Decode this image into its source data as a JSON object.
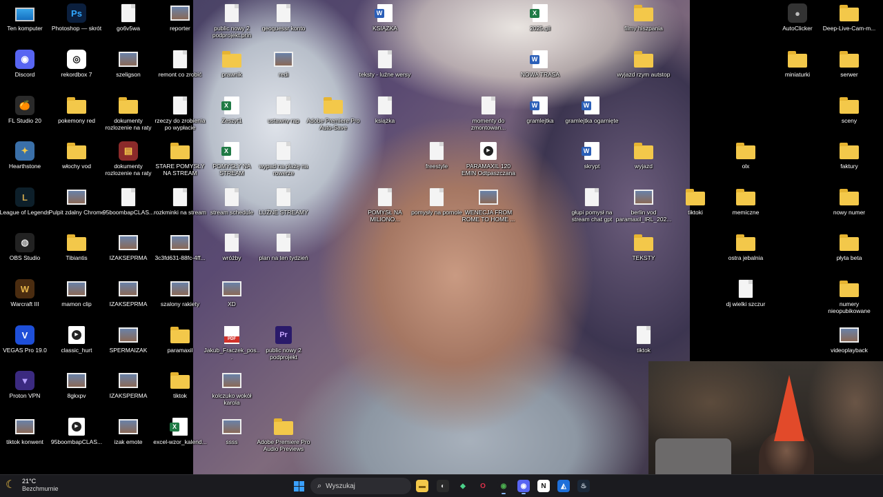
{
  "desktop": {
    "icons": [
      {
        "label": "Ten komputer",
        "type": "monitor"
      },
      {
        "label": "Photoshop — skrót",
        "type": "app",
        "color": "#0b1f3d",
        "text": "Ps",
        "tcolor": "#31a8ff"
      },
      {
        "label": "go6v5wa",
        "type": "doc"
      },
      {
        "label": "reporter",
        "type": "img"
      },
      {
        "label": "public nowy 2 podprojekt.prin",
        "type": "doc"
      },
      {
        "label": "geoguessr konto",
        "type": "doc"
      },
      {
        "label": "KSIĄŻKA",
        "type": "word"
      },
      {
        "label": "2025.gil",
        "type": "excel"
      },
      {
        "label": "filmy hiszpania",
        "type": "folder"
      },
      {
        "label": "AutoClicker",
        "type": "app",
        "color": "#333",
        "text": "●",
        "tcolor": "#bbb"
      },
      {
        "label": "Deep-Live-Cam-m...",
        "type": "folder"
      },
      {
        "label": "Discord",
        "type": "app",
        "color": "#5865f2",
        "text": "◉",
        "tcolor": "#fff"
      },
      {
        "label": "rekordbox 7",
        "type": "app",
        "color": "#fff",
        "text": "◎",
        "tcolor": "#111"
      },
      {
        "label": "szeligson",
        "type": "img"
      },
      {
        "label": "remont co zrobić",
        "type": "doc"
      },
      {
        "label": "prawnik",
        "type": "folder"
      },
      {
        "label": "redi",
        "type": "img"
      },
      {
        "label": "teksty - luźne wersy",
        "type": "doc"
      },
      {
        "label": "NOWA TRASA",
        "type": "word"
      },
      {
        "label": "wyjazd rzym autstop",
        "type": "folder"
      },
      {
        "label": "miniaturki",
        "type": "folder"
      },
      {
        "label": "serwer",
        "type": "folder"
      },
      {
        "label": "FL Studio 20",
        "type": "app",
        "color": "#2a2a2a",
        "text": "🍊",
        "tcolor": "#f90"
      },
      {
        "label": "pokemony red",
        "type": "folder"
      },
      {
        "label": "dokumenty rozlozenie na raty",
        "type": "folder"
      },
      {
        "label": "rzeczy do zrobienia po wypłacie",
        "type": "doc"
      },
      {
        "label": "Zeszyt1",
        "type": "excel"
      },
      {
        "label": "ustawny rap",
        "type": "doc"
      },
      {
        "label": "Adobe Premiere Pro Auto-Save",
        "type": "folder"
      },
      {
        "label": "książka",
        "type": "doc"
      },
      {
        "label": "momenty do zmontowan...",
        "type": "doc"
      },
      {
        "label": "gramlejtka",
        "type": "word"
      },
      {
        "label": "gramlejtka ogarnięte",
        "type": "word"
      },
      {
        "label": "sceny",
        "type": "folder"
      },
      {
        "label": "Hearthstone",
        "type": "app",
        "color": "#3a6fa8",
        "text": "✦",
        "tcolor": "#f1c84b"
      },
      {
        "label": "włochy vod",
        "type": "folder"
      },
      {
        "label": "dokumenty rozlozenie na raty",
        "type": "app",
        "color": "#8b2a2a",
        "text": "▤",
        "tcolor": "#f3c84a"
      },
      {
        "label": "STARE POMYSŁY NA STREAM",
        "type": "folder"
      },
      {
        "label": "POMYSŁY NA STREAM",
        "type": "excel"
      },
      {
        "label": "wypad na plażę na rowerze",
        "type": "doc"
      },
      {
        "label": "freestyle",
        "type": "doc"
      },
      {
        "label": "PARAMAXIL 120 EMIN Odtpaszczana",
        "type": "video"
      },
      {
        "label": "skrypt",
        "type": "word"
      },
      {
        "label": "wyjazd",
        "type": "folder"
      },
      {
        "label": "olx",
        "type": "folder"
      },
      {
        "label": "faktury",
        "type": "folder"
      },
      {
        "label": "League of Legends",
        "type": "app",
        "color": "#0d1f2a",
        "text": "L",
        "tcolor": "#c8a24c"
      },
      {
        "label": "Pulpit zdalny Chrome",
        "type": "img"
      },
      {
        "label": "95boombapCLAS...",
        "type": "doc"
      },
      {
        "label": "rozkminki na stream",
        "type": "doc"
      },
      {
        "label": "stream schedule",
        "type": "doc"
      },
      {
        "label": "LUŹNE STREAMY",
        "type": "doc"
      },
      {
        "label": "POMYSŁ NA MILIONO...",
        "type": "doc"
      },
      {
        "label": "pomysły na pornole",
        "type": "doc"
      },
      {
        "label": "WENECJA FROM ROME TO HOME ...",
        "type": "img"
      },
      {
        "label": "głupi pomysł na stream chat gpt",
        "type": "doc"
      },
      {
        "label": "berlin vod paramaxil_IRL_202...",
        "type": "img"
      },
      {
        "label": "tiktoki",
        "type": "folder"
      },
      {
        "label": "memiczne",
        "type": "folder"
      },
      {
        "label": "nowy numer",
        "type": "folder"
      },
      {
        "label": "OBS Studio",
        "type": "app",
        "color": "#222",
        "text": "◍",
        "tcolor": "#ddd"
      },
      {
        "label": "Tibiantis",
        "type": "folder"
      },
      {
        "label": "IZAKSEPRMA",
        "type": "img"
      },
      {
        "label": "3c3fd631-88fc-4ff...",
        "type": "img"
      },
      {
        "label": "wróżby",
        "type": "doc"
      },
      {
        "label": "plan na ten tydzień",
        "type": "doc"
      },
      {
        "label": "TEKSTY",
        "type": "folder"
      },
      {
        "label": "ostra jebalnia",
        "type": "folder"
      },
      {
        "label": "płyta beta",
        "type": "folder"
      },
      {
        "label": "Warcraft III",
        "type": "app",
        "color": "#4a2c10",
        "text": "W",
        "tcolor": "#e7b64a"
      },
      {
        "label": "mamon clip",
        "type": "img"
      },
      {
        "label": "IZAKSEPRMA",
        "type": "img"
      },
      {
        "label": "szalony rakiety",
        "type": "img"
      },
      {
        "label": "XD",
        "type": "img"
      },
      {
        "label": "dj wielki szczur",
        "type": "doc"
      },
      {
        "label": "numery nieopubikowane",
        "type": "folder"
      },
      {
        "label": "VEGAS Pro 19.0",
        "type": "app",
        "color": "#1e4fd8",
        "text": "V",
        "tcolor": "#fff"
      },
      {
        "label": "classic_hurt",
        "type": "video"
      },
      {
        "label": "SPERMAIZAK",
        "type": "img"
      },
      {
        "label": "paramaxil",
        "type": "folder"
      },
      {
        "label": "Jakub_Fraczek_pos...",
        "type": "pdf"
      },
      {
        "label": "public nowy 2 podprojekt",
        "type": "pr"
      },
      {
        "label": "tiktok",
        "type": "doc"
      },
      {
        "label": "videoplayback",
        "type": "img"
      },
      {
        "label": "Proton VPN",
        "type": "app",
        "color": "#3b2a80",
        "text": "▼",
        "tcolor": "#b6a0ff"
      },
      {
        "label": "8gkxpv",
        "type": "img"
      },
      {
        "label": "IZAKSPERMA",
        "type": "img"
      },
      {
        "label": "tiktok",
        "type": "folder"
      },
      {
        "label": "kolczuko wokół karola",
        "type": "img"
      },
      {
        "label": "tiktok konwent",
        "type": "img"
      },
      {
        "label": "95boombapCLAS...",
        "type": "video"
      },
      {
        "label": "izak emote",
        "type": "img"
      },
      {
        "label": "excel-wzor_kalend...",
        "type": "excel"
      },
      {
        "label": "ssss",
        "type": "img"
      },
      {
        "label": "Adobe Premiere Pro Audio Previews",
        "type": "folder"
      }
    ]
  },
  "taskbar": {
    "weather": {
      "temp": "21°C",
      "condition": "Bezchmurnie",
      "icon": "moon-icon"
    },
    "search_placeholder": "Wyszukaj",
    "apps": [
      {
        "name": "file-explorer-icon",
        "glyph": "▬",
        "bg": "#f3c84a",
        "fg": "#7a5a10"
      },
      {
        "name": "recorder-icon",
        "glyph": "◐",
        "bg": "#2a2a2a",
        "fg": "#ddd"
      },
      {
        "name": "shield-icon",
        "glyph": "◆",
        "bg": "#1b1b1f",
        "fg": "#4bd18a"
      },
      {
        "name": "opera-icon",
        "glyph": "O",
        "bg": "#1b1b1f",
        "fg": "#e0314b"
      },
      {
        "name": "chrome-icon",
        "glyph": "◉",
        "bg": "#1b1b1f",
        "fg": "#4caf50"
      },
      {
        "name": "discord-icon",
        "glyph": "◉",
        "bg": "#5865f2",
        "fg": "#fff"
      },
      {
        "name": "notion-icon",
        "glyph": "N",
        "bg": "#fff",
        "fg": "#111"
      },
      {
        "name": "bluestacks-icon",
        "glyph": "◭",
        "bg": "#1e6fd9",
        "fg": "#fff"
      },
      {
        "name": "steam-icon",
        "glyph": "♨",
        "bg": "#1b2838",
        "fg": "#cfd8e3"
      }
    ]
  }
}
